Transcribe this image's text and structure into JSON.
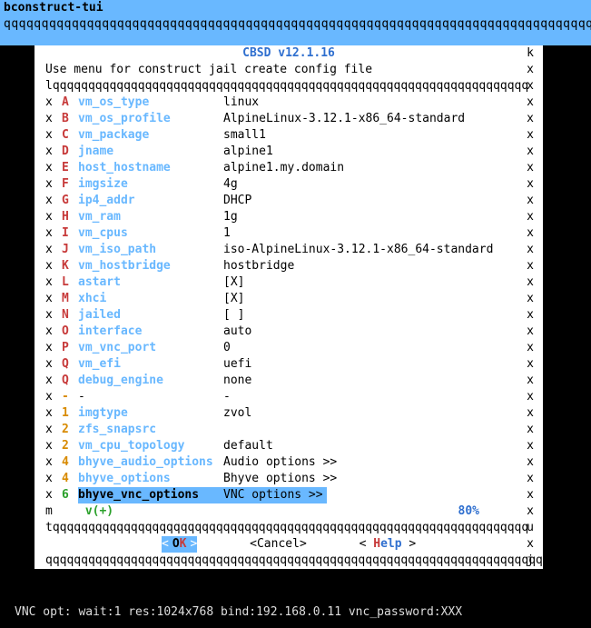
{
  "header": {
    "title": "bconstruct-tui",
    "qline": "qqqqqqqqqqqqqqqqqqqqqqqqqqqqqqqqqqqqqqqqqqqqqqqqqqqqqqqqqqqqqqqqqqqqqqqqqqqqqqqqqqqq"
  },
  "panel": {
    "title": "CBSD v12.1.16",
    "subtitle": "Use menu for construct jail create config file",
    "lq": "lqqqqqqqqqqqqqqqqqqqqqqqqqqqqqqqqqqqqqqqqqqqqqqqqqqqqqqqqqqqqqqqqqqq",
    "corner_k": "k",
    "corner_x": "x",
    "corner_m": "m",
    "corner_u": "u",
    "corner_j": "j",
    "vplus": "v(+)",
    "percent": "80%",
    "tq": "tqqqqqqqqqqqqqqqqqqqqqqqqqqqqqqqqqqqqqqqqqqqqqqqqqqqqqqqqqqqqqqqqqqq",
    "qbot": "qqqqqqqqqqqqqqqqqqqqqqqqqqqqqqqqqqqqqqqqqqqqqqqqqqqqqqqqqqqqqqqqqqqqqqqqqqqqqqqq"
  },
  "buttons": {
    "ok": "OK",
    "cancel": "Cancel",
    "help": "Help"
  },
  "menu": [
    {
      "key": "A",
      "kc": "red",
      "name": "vm_os_type",
      "val": "linux"
    },
    {
      "key": "B",
      "kc": "red",
      "name": "vm_os_profile",
      "val": "AlpineLinux-3.12.1-x86_64-standard"
    },
    {
      "key": "C",
      "kc": "red",
      "name": "vm_package",
      "val": "small1"
    },
    {
      "key": "D",
      "kc": "red",
      "name": "jname",
      "val": "alpine1"
    },
    {
      "key": "E",
      "kc": "red",
      "name": "host_hostname",
      "val": "alpine1.my.domain"
    },
    {
      "key": "F",
      "kc": "red",
      "name": "imgsize",
      "val": "4g"
    },
    {
      "key": "G",
      "kc": "red",
      "name": "ip4_addr",
      "val": "DHCP"
    },
    {
      "key": "H",
      "kc": "red",
      "name": "vm_ram",
      "val": "1g"
    },
    {
      "key": "I",
      "kc": "red",
      "name": "vm_cpus",
      "val": "1"
    },
    {
      "key": "J",
      "kc": "red",
      "name": "vm_iso_path",
      "val": "iso-AlpineLinux-3.12.1-x86_64-standard"
    },
    {
      "key": "K",
      "kc": "red",
      "name": "vm_hostbridge",
      "val": "hostbridge"
    },
    {
      "key": "L",
      "kc": "red",
      "name": "astart",
      "val": "[X]"
    },
    {
      "key": "M",
      "kc": "red",
      "name": "xhci",
      "val": "[X]"
    },
    {
      "key": "N",
      "kc": "red",
      "name": "jailed",
      "val": "[ ]"
    },
    {
      "key": "O",
      "kc": "red",
      "name": "interface",
      "val": "auto"
    },
    {
      "key": "P",
      "kc": "red",
      "name": "vm_vnc_port",
      "val": "0"
    },
    {
      "key": "Q",
      "kc": "red",
      "name": "vm_efi",
      "val": "uefi"
    },
    {
      "key": "Q",
      "kc": "red",
      "name": "debug_engine",
      "val": "none"
    },
    {
      "key": "-",
      "kc": "orange",
      "name": "-",
      "val": "-",
      "plain": true
    },
    {
      "key": "1",
      "kc": "orange",
      "name": "imgtype",
      "val": "zvol"
    },
    {
      "key": "2",
      "kc": "orange",
      "name": "zfs_snapsrc",
      "val": ""
    },
    {
      "key": "2",
      "kc": "orange",
      "name": "vm_cpu_topology",
      "val": "default"
    },
    {
      "key": "4",
      "kc": "orange",
      "name": "bhyve_audio_options",
      "val": "Audio options >>"
    },
    {
      "key": "4",
      "kc": "orange",
      "name": "bhyve_options",
      "val": "Bhyve options >>"
    },
    {
      "key": "6",
      "kc": "green",
      "name": "bhyve_vnc_options",
      "val": "VNC options >>",
      "selected": true
    }
  ],
  "status": "VNC opt: wait:1 res:1024x768 bind:192.168.0.11 vnc_password:XXX"
}
